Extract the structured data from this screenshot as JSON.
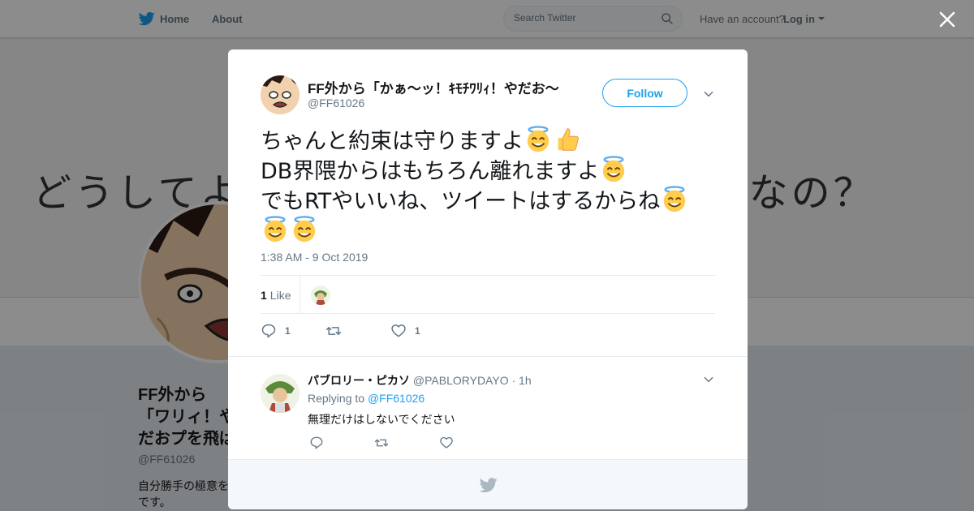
{
  "nav": {
    "home": "Home",
    "about": "About",
    "search_placeholder": "Search Twitter",
    "account_prompt": "Have an account?",
    "login": "Log in"
  },
  "banner": {
    "left": "どうしてよ",
    "right": "勝手なの？"
  },
  "profile": {
    "name": "FF外から「かぁ〜ッ！ｷﾓﾁﾜﾘｨ！やだお〜",
    "name_visible": "FF外から「ワリィ！やだおプを飛ばす",
    "handle": "@FF61026",
    "bio": "自分勝手の極意を です。"
  },
  "tweet": {
    "author_name": "FF外から「かぁ〜ッ！ｷﾓﾁﾜﾘｨ！やだお〜",
    "author_handle": "@FF61026",
    "follow_label": "Follow",
    "lines": [
      "ちゃんと約束は守りますよ",
      "DB界隈からはもちろん離れますよ",
      "でもRTやいいね、ツイートはするからね"
    ],
    "timestamp": "1:38 AM - 9 Oct 2019",
    "likes_count": "1",
    "likes_label": "Like",
    "reply_count": "1",
    "like_count": "1"
  },
  "reply": {
    "name": "パブロリー・ピカソ",
    "handle": "@PABLORYDAYO",
    "time": "· 1h",
    "replying_label": "Replying to",
    "replying_to": "@FF61026",
    "text": "無理だけはしないでください"
  },
  "colors": {
    "accent": "#1da1f2",
    "muted": "#657786",
    "text": "#14171a"
  }
}
